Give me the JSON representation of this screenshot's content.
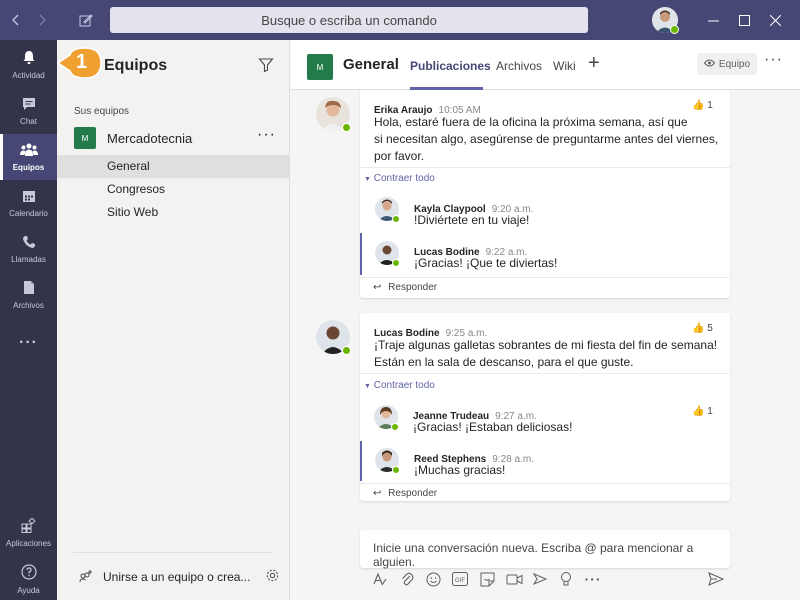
{
  "titlebar": {
    "search_placeholder": "Busque o escriba un comando"
  },
  "appbar": {
    "items": [
      {
        "label": "Actividad",
        "icon": "bell-icon"
      },
      {
        "label": "Chat",
        "icon": "chat-icon"
      },
      {
        "label": "Equipos",
        "icon": "teams-icon"
      },
      {
        "label": "Calendario",
        "icon": "calendar-icon"
      },
      {
        "label": "Llamadas",
        "icon": "phone-icon"
      },
      {
        "label": "Archivos",
        "icon": "file-icon"
      },
      {
        "label": "Aplicaciones",
        "icon": "apps-icon"
      },
      {
        "label": "Ayuda",
        "icon": "help-icon"
      }
    ],
    "more": "···"
  },
  "callout": {
    "number": "1"
  },
  "teams_panel": {
    "title": "Equipos",
    "section_label": "Sus equipos",
    "team": {
      "initial": "M",
      "name": "Mercadotecnia",
      "more": "···"
    },
    "channels": [
      "General",
      "Congresos",
      "Sitio Web"
    ],
    "join_label": "Unirse a un equipo o crea..."
  },
  "channel_header": {
    "initial": "M",
    "name": "General",
    "tabs": [
      "Publicaciones",
      "Archivos",
      "Wiki"
    ],
    "add": "+",
    "team_button": "Equipo",
    "more": "···"
  },
  "threads": [
    {
      "author": "Erika Araujo",
      "time": "10:05 AM",
      "text": [
        "Hola, estaré fuera de la oficina la próxima semana, así que",
        "si necesitan algo, asegúrense de preguntarme antes del viernes,",
        "por favor."
      ],
      "likes": "1",
      "collapse": "Contraer todo",
      "replies": [
        {
          "author": "Kayla Claypool",
          "time": "9:20 a.m.",
          "text": "!Diviértete en tu viaje!"
        },
        {
          "author": "Lucas Bodine",
          "time": "9:22 a.m.",
          "text": "¡Gracias! ¡Que te diviertas!"
        }
      ],
      "reply_label": "Responder"
    },
    {
      "author": "Lucas Bodine",
      "time": "9:25 a.m.",
      "text": [
        "¡Traje algunas galletas sobrantes de mi fiesta del fin de semana!",
        "Están en la sala de descanso, para el que guste."
      ],
      "likes": "5",
      "collapse": "Contraer todo",
      "replies": [
        {
          "author": "Jeanne Trudeau",
          "time": "9:27 a.m.",
          "text": "¡Gracias! ¡Estaban deliciosas!",
          "likes": "1"
        },
        {
          "author": "Reed Stephens",
          "time": "9:28 a.m.",
          "text": "¡Muchas gracias!"
        }
      ],
      "reply_label": "Responder"
    }
  ],
  "compose": {
    "placeholder": "Inicie una conversación nueva. Escriba @ para mencionar a alguien."
  },
  "colors": {
    "titlebar": "#464775",
    "appbar": "#33344a",
    "accent": "#6264a7",
    "team_green": "#237b4b",
    "callout": "#f0a030",
    "presence": "#6bb700"
  }
}
